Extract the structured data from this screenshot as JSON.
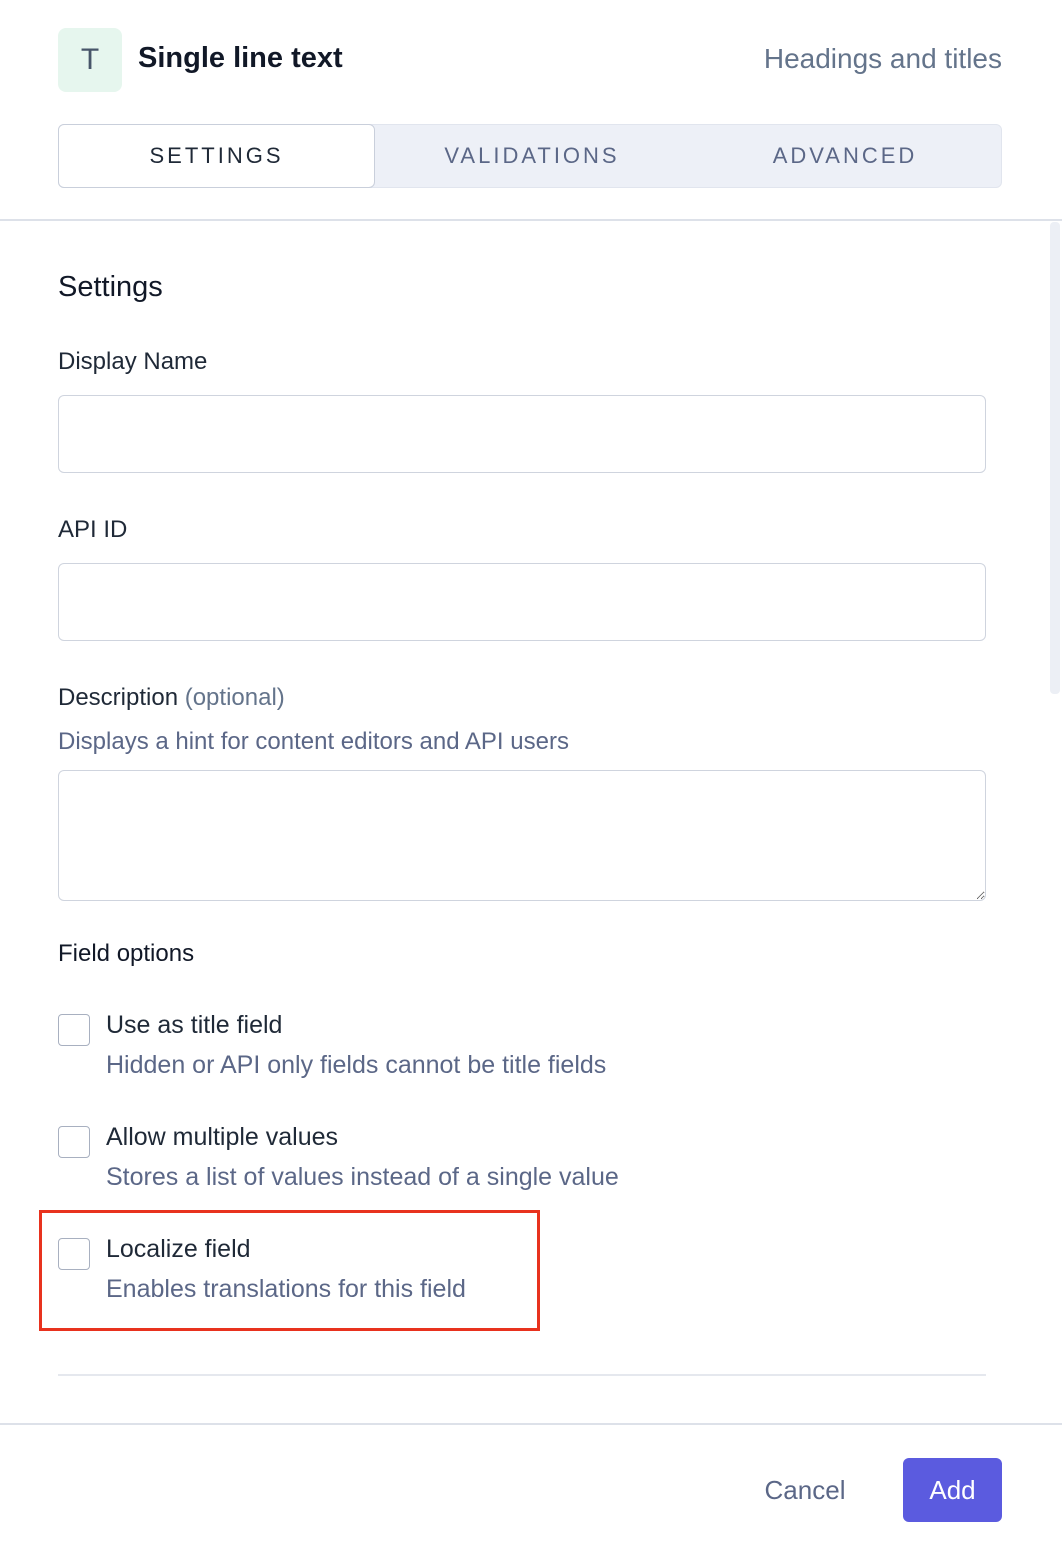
{
  "header": {
    "type_icon": "T",
    "field_type": "Single line text",
    "category": "Headings and titles"
  },
  "tabs": [
    {
      "label": "SETTINGS",
      "active": true
    },
    {
      "label": "VALIDATIONS",
      "active": false
    },
    {
      "label": "ADVANCED",
      "active": false
    }
  ],
  "settings": {
    "section_title": "Settings",
    "display_name": {
      "label": "Display Name",
      "value": ""
    },
    "api_id": {
      "label": "API ID",
      "value": ""
    },
    "description": {
      "label": "Description",
      "optional": "(optional)",
      "hint": "Displays a hint for content editors and API users",
      "value": ""
    },
    "field_options": {
      "title": "Field options",
      "items": [
        {
          "label": "Use as title field",
          "description": "Hidden or API only fields cannot be title fields",
          "checked": false
        },
        {
          "label": "Allow multiple values",
          "description": "Stores a list of values instead of a single value",
          "checked": false
        },
        {
          "label": "Localize field",
          "description": "Enables translations for this field",
          "checked": false,
          "highlighted": true
        }
      ]
    }
  },
  "footer": {
    "cancel_label": "Cancel",
    "add_label": "Add"
  },
  "colors": {
    "accent": "#5b5bdf",
    "highlight": "#e8321e",
    "type_badge_bg": "#e6f6ee"
  }
}
